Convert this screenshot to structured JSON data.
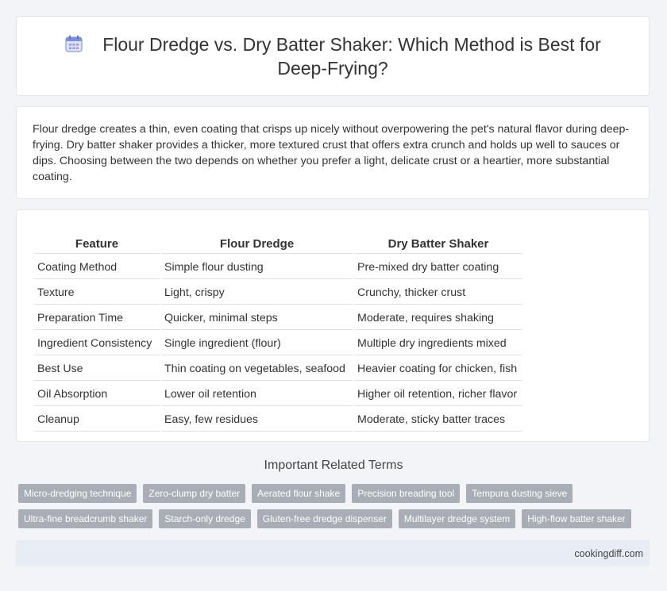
{
  "header": {
    "title": "Flour Dredge vs. Dry Batter Shaker: Which Method is Best for Deep-Frying?",
    "icon": "calendar-icon"
  },
  "intro": {
    "text": "Flour dredge creates a thin, even coating that crisps up nicely without overpowering the pet's natural flavor during deep-frying. Dry batter shaker provides a thicker, more textured crust that offers extra crunch and holds up well to sauces or dips. Choosing between the two depends on whether you prefer a light, delicate crust or a heartier, more substantial coating."
  },
  "table": {
    "headers": [
      "Feature",
      "Flour Dredge",
      "Dry Batter Shaker"
    ],
    "rows": [
      [
        "Coating Method",
        "Simple flour dusting",
        "Pre-mixed dry batter coating"
      ],
      [
        "Texture",
        "Light, crispy",
        "Crunchy, thicker crust"
      ],
      [
        "Preparation Time",
        "Quicker, minimal steps",
        "Moderate, requires shaking"
      ],
      [
        "Ingredient Consistency",
        "Single ingredient (flour)",
        "Multiple dry ingredients mixed"
      ],
      [
        "Best Use",
        "Thin coating on vegetables, seafood",
        "Heavier coating for chicken, fish"
      ],
      [
        "Oil Absorption",
        "Lower oil retention",
        "Higher oil retention, richer flavor"
      ],
      [
        "Cleanup",
        "Easy, few residues",
        "Moderate, sticky batter traces"
      ]
    ]
  },
  "related": {
    "title": "Important Related Terms",
    "tags": [
      "Micro-dredging technique",
      "Zero-clump dry batter",
      "Aerated flour shake",
      "Precision breading tool",
      "Tempura dusting sieve",
      "Ultra-fine breadcrumb shaker",
      "Starch-only dredge",
      "Gluten-free dredge dispenser",
      "Multilayer dredge system",
      "High-flow batter shaker"
    ]
  },
  "footer": {
    "site": "cookingdiff.com"
  }
}
